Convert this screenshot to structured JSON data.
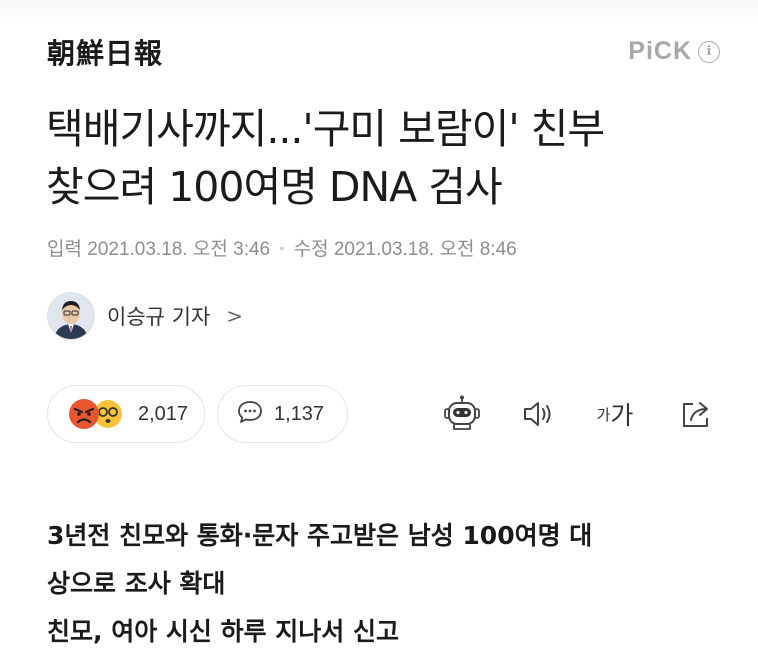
{
  "header": {
    "brand": "朝鮮日報",
    "pick_label": "PiCK",
    "info_icon": "info-icon"
  },
  "article": {
    "headline_line1": "택배기사까지...'구미 보람이' 친부",
    "headline_line2": "찾으려 100여명 DNA 검사",
    "published_label": "입력",
    "published": "2021.03.18. 오전 3:46",
    "updated_label": "수정",
    "updated": "2021.03.18. 오전 8:46",
    "reporter": "이승규 기자",
    "reporter_chevron": ">"
  },
  "actions": {
    "reaction_count": "2,017",
    "reaction_icons": [
      "angry-face-icon",
      "surprised-face-icon"
    ],
    "comment_count": "1,137",
    "comment_icon": "comment-icon",
    "tools": [
      "robot-summary-icon",
      "speaker-icon",
      "font-size-icon",
      "share-icon"
    ],
    "font_small": "가",
    "font_big": "가"
  },
  "summary": {
    "line1": "3년전 친모와 통화·문자 주고받은 남성 100여명 대",
    "line2": "상으로 조사 확대",
    "line3": "친모, 여아 시신 하루 지나서 신고"
  },
  "colors": {
    "accent_gray": "#a8a8a8",
    "meta_gray": "#8d8d8d",
    "angry_red": "#e8552f",
    "surprised_yellow": "#f6c33b"
  }
}
